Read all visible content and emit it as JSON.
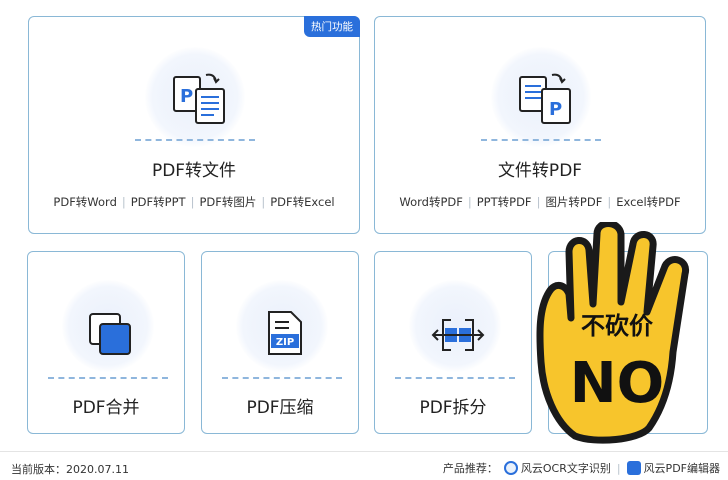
{
  "cards": {
    "pdf_to_file": {
      "badge": "热门功能",
      "title": "PDF转文件",
      "links": [
        "PDF转Word",
        "PDF转PPT",
        "PDF转图片",
        "PDF转Excel"
      ]
    },
    "file_to_pdf": {
      "title": "文件转PDF",
      "links": [
        "Word转PDF",
        "PPT转PDF",
        "图片转PDF",
        "Excel转PDF"
      ]
    },
    "pdf_merge": {
      "title": "PDF合并"
    },
    "pdf_compress": {
      "title": "PDF压缩",
      "icon_text": "ZIP"
    },
    "pdf_split": {
      "title": "PDF拆分"
    }
  },
  "footer": {
    "version": "当前版本：2020.07.11",
    "products_label": "产品推荐：",
    "products": [
      "风云OCR文字识别",
      "风云PDF编辑器"
    ]
  },
  "sticker": {
    "text_top": "不砍价",
    "text_big": "NO"
  },
  "colors": {
    "accent": "#2a6fdb",
    "card_border": "#8ab8d6",
    "sticker_fill": "#f7c52c"
  }
}
